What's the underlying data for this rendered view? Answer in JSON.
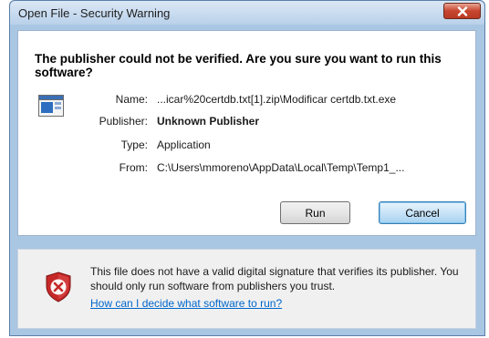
{
  "window": {
    "title": "Open File - Security Warning"
  },
  "dialog": {
    "heading": "The publisher could not be verified.  Are you sure you want to run this software?",
    "fields": [
      {
        "label": "Name:",
        "value": "...icar%20certdb.txt[1].zip\\Modificar certdb.txt.exe",
        "bold": false
      },
      {
        "label": "Publisher:",
        "value": "Unknown Publisher",
        "bold": true
      },
      {
        "label": "Type:",
        "value": "Application",
        "bold": false
      },
      {
        "label": "From:",
        "value": "C:\\Users\\mmoreno\\AppData\\Local\\Temp\\Temp1_...",
        "bold": false
      }
    ],
    "buttons": {
      "run": "Run",
      "cancel": "Cancel"
    }
  },
  "footer": {
    "warning_text": "This file does not have a valid digital signature that verifies its publisher.  You should only run software from publishers you trust.",
    "help_link": "How can I decide what software to run?"
  },
  "colors": {
    "accent": "#0066cc",
    "close_button": "#c7452f",
    "shield": "#c62828"
  },
  "icons": [
    "close-icon",
    "application-icon",
    "security-shield-icon"
  ]
}
